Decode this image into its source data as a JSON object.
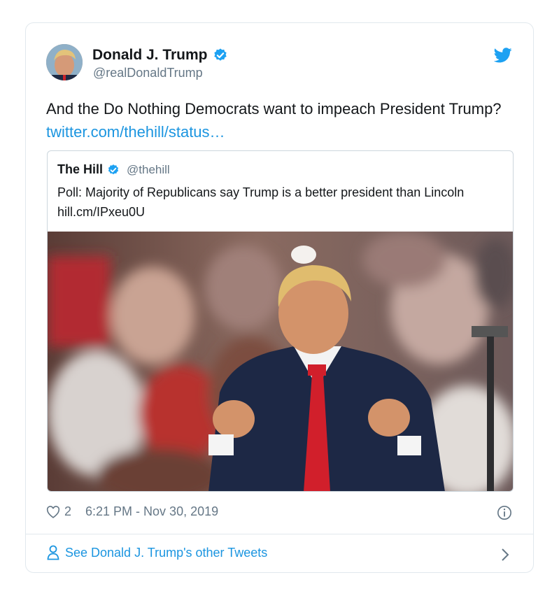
{
  "author": {
    "name": "Donald J. Trump",
    "handle": "@realDonaldTrump"
  },
  "tweet": {
    "text": "And the Do Nothing Democrats want to impeach President Trump? ",
    "link": "twitter.com/thehill/status…"
  },
  "quoted": {
    "name": "The Hill",
    "handle": "@thehill",
    "text": "Poll: Majority of Republicans say Trump is a better president than Lincoln hill.cm/IPxeu0U"
  },
  "meta": {
    "likes": "2",
    "timestamp": "6:21 PM - Nov 30, 2019"
  },
  "footer": {
    "see_more": "See Donald J. Trump's other Tweets"
  },
  "colors": {
    "accent": "#1b95e0",
    "verified": "#1da1f2",
    "muted": "#657786"
  },
  "icons": [
    "verified-badge-icon",
    "twitter-bird-icon",
    "heart-icon",
    "info-icon",
    "person-icon",
    "chevron-right-icon"
  ]
}
